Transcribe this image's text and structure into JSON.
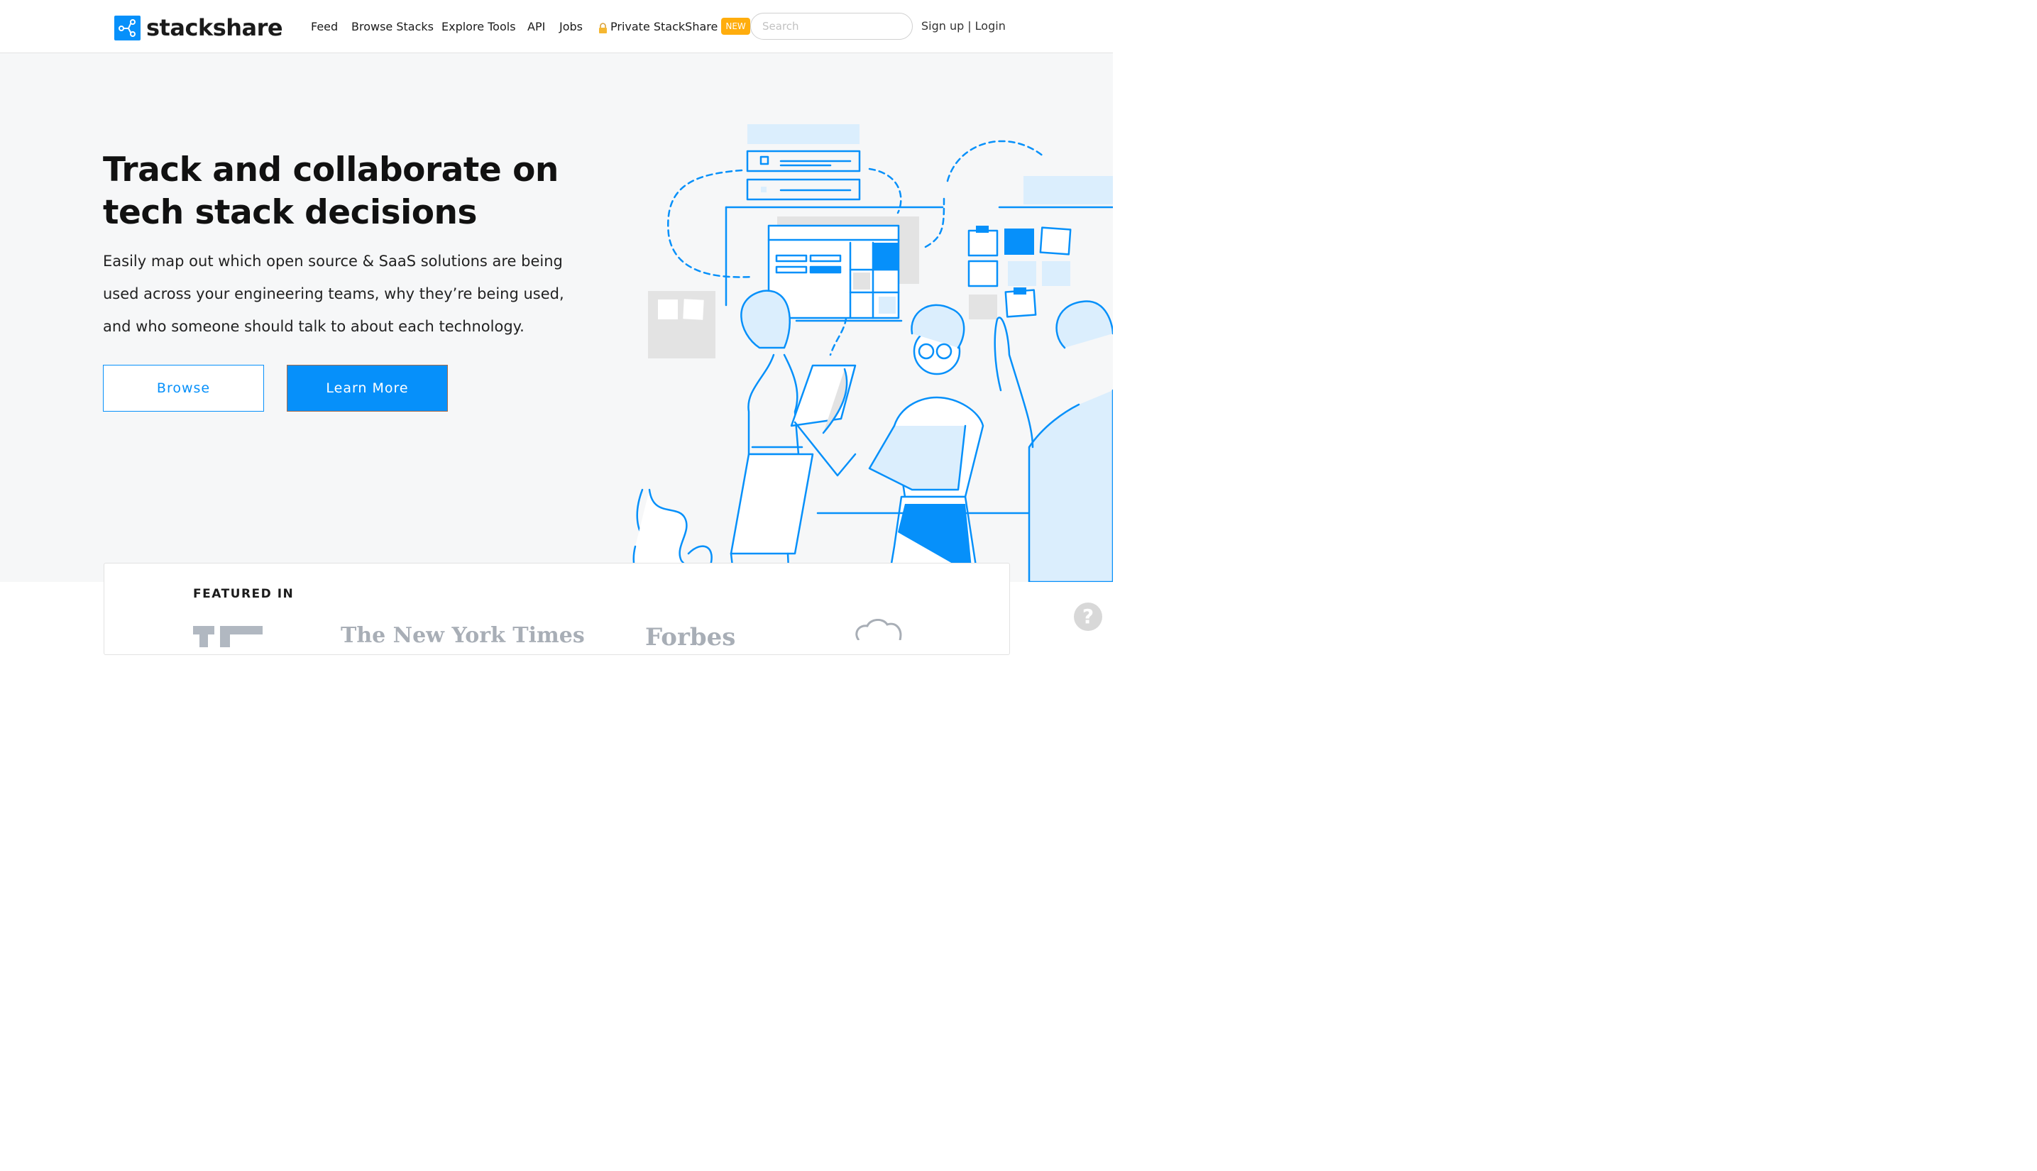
{
  "header": {
    "logo_text": "stackshare",
    "logo_icon": "share-nodes-icon",
    "nav": {
      "feed": "Feed",
      "browse_stacks": "Browse Stacks",
      "explore_tools": "Explore Tools",
      "api": "API",
      "jobs": "Jobs",
      "private": "Private StackShare",
      "new_badge": "NEW"
    },
    "search_placeholder": "Search",
    "signup": "Sign up",
    "separator": "|",
    "login": "Login"
  },
  "hero": {
    "title": "Track and collaborate on tech stack decisions",
    "subtitle": "Easily map out which open source & SaaS solutions are being used across your engineering teams, why they’re being used, and who someone should talk to about each technology.",
    "browse_button": "Browse",
    "learn_more_button": "Learn More"
  },
  "featured": {
    "label": "FEATURED IN",
    "logos": [
      "The New York Times",
      "Forbes"
    ]
  },
  "help": {
    "label": "?"
  },
  "colors": {
    "brand_blue": "#0690fa",
    "badge_orange": "#ffad0d",
    "hero_bg": "#f6f7f8"
  }
}
